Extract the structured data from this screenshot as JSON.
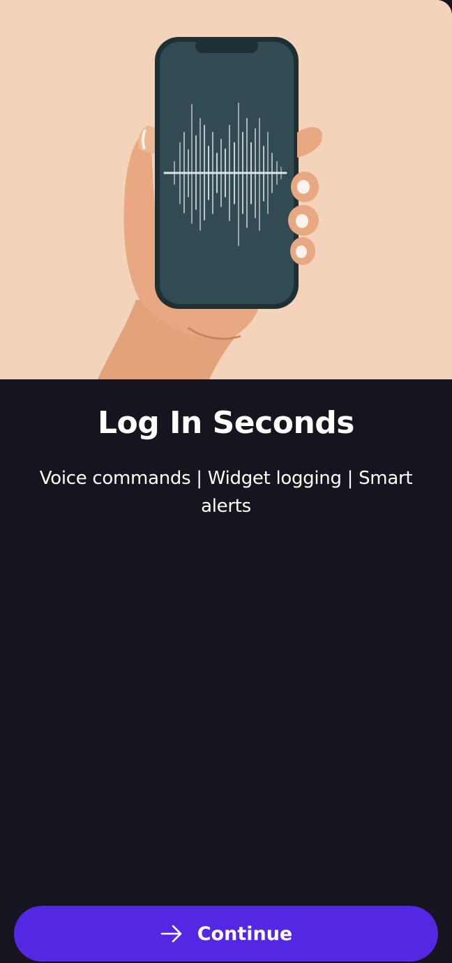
{
  "onboarding": {
    "illustration": "hand-holding-phone-with-voice-waveform",
    "title": "Log In Seconds",
    "subtitle": "Voice commands | Widget logging | Smart alerts",
    "continue_label": "Continue",
    "continue_icon": "arrow-right-icon"
  },
  "colors": {
    "background": "#16141f",
    "illustration_background": "#f4d3bb",
    "accent": "#5428e3",
    "text": "#ffffff"
  }
}
